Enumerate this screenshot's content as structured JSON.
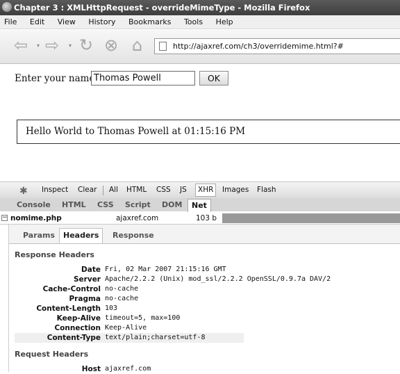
{
  "window": {
    "title": "Chapter 3 : XMLHttpRequest - overrideMimeType - Mozilla Firefox"
  },
  "menu": [
    "File",
    "Edit",
    "View",
    "History",
    "Bookmarks",
    "Tools",
    "Help"
  ],
  "nav": {
    "url": "http://ajaxref.com/ch3/overridemime.html?#"
  },
  "page": {
    "name_label": "Enter your name:",
    "name_value": "Thomas Powell",
    "ok_label": "OK",
    "message": "Hello World to Thomas Powell at 01:15:16 PM"
  },
  "firebug": {
    "toolbar": [
      "Inspect",
      "Clear",
      "All",
      "HTML",
      "CSS",
      "JS",
      "XHR",
      "Images",
      "Flash"
    ],
    "tabs": [
      "Console",
      "HTML",
      "CSS",
      "Script",
      "DOM",
      "Net"
    ],
    "request": {
      "file": "nomime.php",
      "domain": "ajaxref.com",
      "size": "103 b"
    },
    "detail_tabs": [
      "Params",
      "Headers",
      "Response"
    ],
    "response_title": "Response Headers",
    "response_headers": [
      {
        "name": "Date",
        "value": "Fri, 02 Mar 2007 21:15:16 GMT"
      },
      {
        "name": "Server",
        "value": "Apache/2.2.2 (Unix) mod_ssl/2.2.2 OpenSSL/0.9.7a DAV/2"
      },
      {
        "name": "Cache-Control",
        "value": "no-cache"
      },
      {
        "name": "Pragma",
        "value": "no-cache"
      },
      {
        "name": "Content-Length",
        "value": "103"
      },
      {
        "name": "Keep-Alive",
        "value": "timeout=5, max=100"
      },
      {
        "name": "Connection",
        "value": "Keep-Alive"
      },
      {
        "name": "Content-Type",
        "value": "text/plain;charset=utf-8"
      }
    ],
    "request_title": "Request Headers",
    "request_headers": [
      {
        "name": "Host",
        "value": "ajaxref.com"
      }
    ]
  }
}
